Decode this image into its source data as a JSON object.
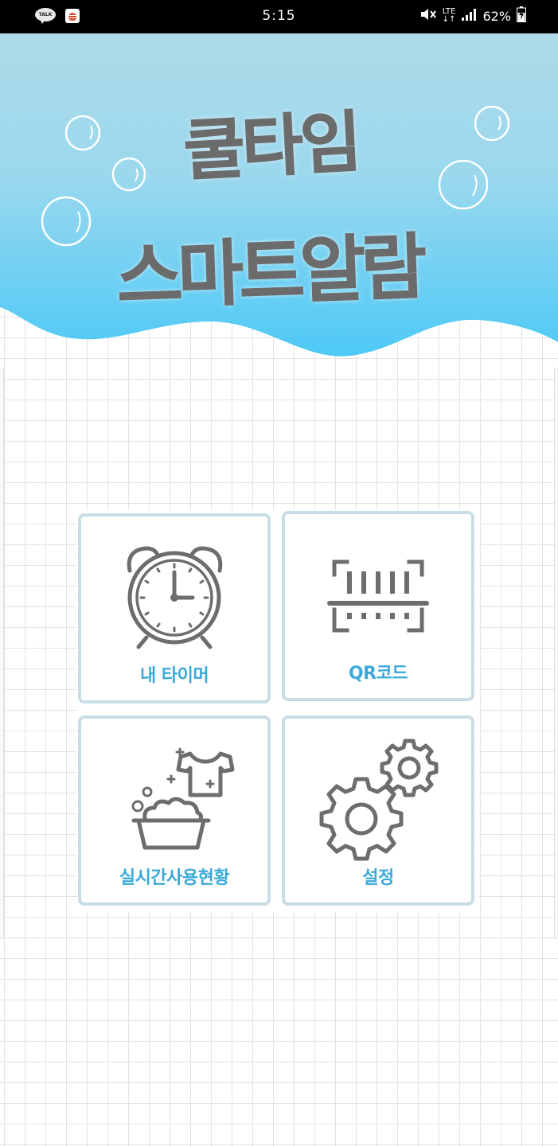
{
  "status_bar": {
    "time": "5:15",
    "network": "LTE",
    "battery": "62%",
    "icons": [
      "kakaotalk-notification-icon",
      "burger-app-notification-icon",
      "mute-icon",
      "lte-icon",
      "signal-icon",
      "battery-charging-icon"
    ]
  },
  "header": {
    "title_line1": "쿨타임",
    "title_line2": "스마트알람",
    "colors": {
      "sky_top": "#aedbe9",
      "sky_bottom": "#4dc9f6",
      "title_text": "#6b6b6b"
    }
  },
  "menu": {
    "accent_color": "#3aa9d9",
    "tile_border_color": "#c8dde6",
    "items": [
      {
        "label": "내 타이머",
        "icon": "alarm-clock-icon"
      },
      {
        "label": "QR코드",
        "icon": "barcode-scan-icon"
      },
      {
        "label": "실시간사용현황",
        "icon": "laundry-basin-icon"
      },
      {
        "label": "설정",
        "icon": "gears-icon"
      }
    ]
  }
}
